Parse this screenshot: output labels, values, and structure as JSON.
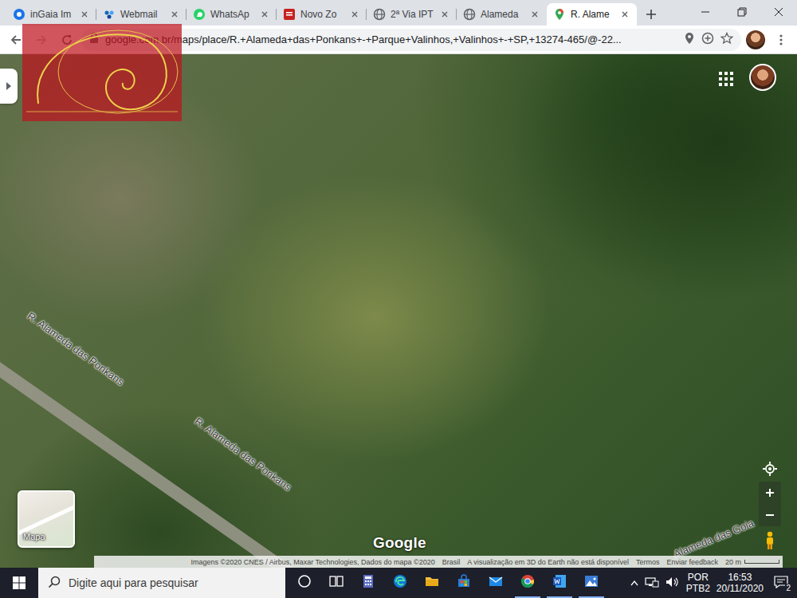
{
  "tabs": [
    {
      "label": "inGaia Im",
      "kind": "ingaia",
      "selected": false
    },
    {
      "label": "Webmail",
      "kind": "webmail",
      "selected": false
    },
    {
      "label": "WhatsAp",
      "kind": "whatsapp",
      "selected": false
    },
    {
      "label": "Novo Zo",
      "kind": "pdf",
      "selected": false
    },
    {
      "label": "2ª Via IPT",
      "kind": "globe",
      "selected": false
    },
    {
      "label": "Alameda",
      "kind": "globe",
      "selected": false
    },
    {
      "label": "R. Alame",
      "kind": "maps",
      "selected": true
    }
  ],
  "address": {
    "url": "google.com.br/maps/place/R.+Alameda+das+Ponkans+-+Parque+Valinhos,+Valinhos+-+SP,+13274-465/@-22..."
  },
  "map": {
    "labels": [
      {
        "text": "R. Alameda das Ponkans"
      },
      {
        "text": "R. Alameda das Ponkans"
      },
      {
        "text": "Alameda das Goia"
      }
    ],
    "layer_button": "Mapa",
    "logo": "Google",
    "attribution": {
      "copyright": "Imagens ©2020 CNES / Airbus, Maxar Technologies, Dados do mapa ©2020",
      "country": "Brasil",
      "notice": "A visualização em 3D do Earth não está disponível",
      "terms": "Termos",
      "feedback": "Enviar feedback",
      "scale": "20 m"
    }
  },
  "taskbar": {
    "search_placeholder": "Digite aqui para pesquisar",
    "pinned": [
      {
        "kind": "cortana",
        "open": false
      },
      {
        "kind": "taskview",
        "open": false
      },
      {
        "kind": "calculator",
        "open": false
      },
      {
        "kind": "edge",
        "open": false
      },
      {
        "kind": "explorer",
        "open": false
      },
      {
        "kind": "store",
        "open": false
      },
      {
        "kind": "mail",
        "open": false
      },
      {
        "kind": "chrome",
        "open": true
      },
      {
        "kind": "word",
        "open": true
      },
      {
        "kind": "photos",
        "open": true
      }
    ],
    "language": [
      "POR",
      "PTB2"
    ],
    "time": "16:53",
    "date": "20/11/2020",
    "notifications": "2"
  }
}
